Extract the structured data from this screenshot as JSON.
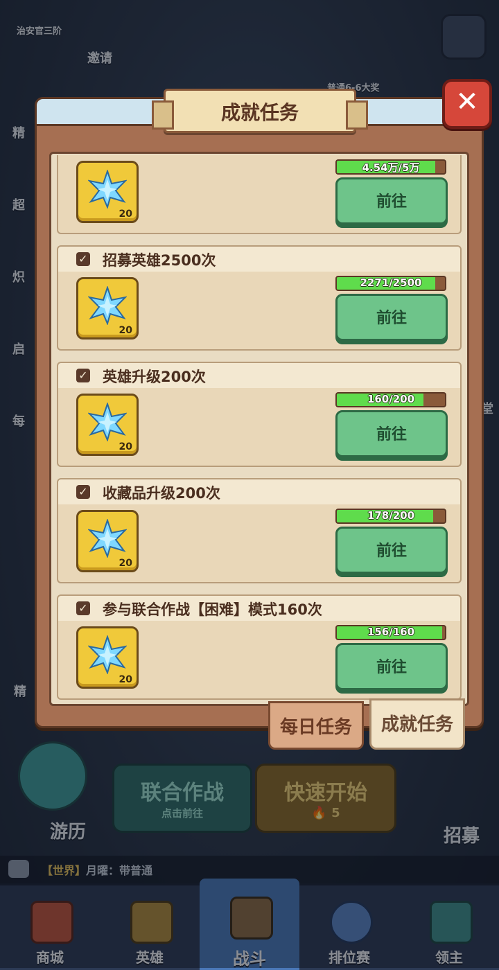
{
  "hud": {
    "rank": "治安官三阶",
    "invite": "邀请",
    "stage_reward": "普通6-6大奖",
    "left_side": [
      "精",
      "超",
      "炽",
      "启",
      "每"
    ],
    "right_side": "堂",
    "fine_btn": "精"
  },
  "lower": {
    "travel": "游历",
    "coop_title": "联合作战",
    "coop_sub": "点击前往",
    "quick_title": "快速开始",
    "quick_cost": "5",
    "recruit": "招募"
  },
  "chat": {
    "channel": "【世界】",
    "message": "月曜：带普通"
  },
  "bottom_nav": [
    {
      "label": "商城"
    },
    {
      "label": "英雄"
    },
    {
      "label": "战斗"
    },
    {
      "label": "排位赛"
    },
    {
      "label": "领主"
    }
  ],
  "modal": {
    "title": "成就任务",
    "tasks": [
      {
        "name": "",
        "reward_qty": "20",
        "progress": "4.54万/5万",
        "progress_frac": 0.908,
        "go_label": "前往"
      },
      {
        "name": "招募英雄2500次",
        "reward_qty": "20",
        "progress": "2271/2500",
        "progress_frac": 0.908,
        "go_label": "前往"
      },
      {
        "name": "英雄升级200次",
        "reward_qty": "20",
        "progress": "160/200",
        "progress_frac": 0.8,
        "go_label": "前往"
      },
      {
        "name": "收藏品升级200次",
        "reward_qty": "20",
        "progress": "178/200",
        "progress_frac": 0.89,
        "go_label": "前往"
      },
      {
        "name": "参与联合作战【困难】模式160次",
        "reward_qty": "20",
        "progress": "156/160",
        "progress_frac": 0.975,
        "go_label": "前往"
      }
    ],
    "tabs": {
      "daily": "每日任务",
      "achievement": "成就任务"
    }
  }
}
